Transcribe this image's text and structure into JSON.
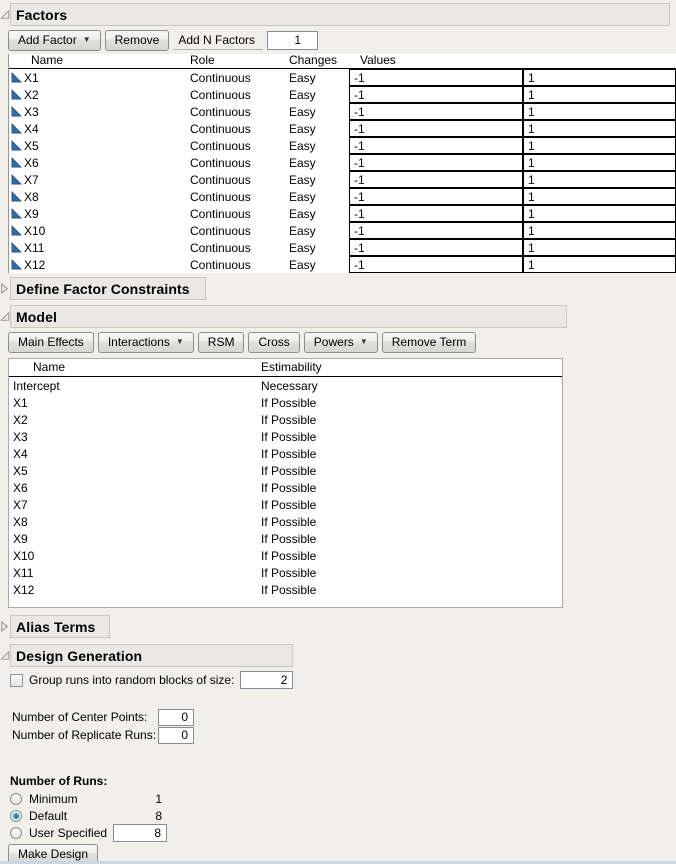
{
  "icons": {
    "dropdown_arrow": "▼"
  },
  "factors": {
    "title": "Factors",
    "toolbar": {
      "add_factor": "Add Factor",
      "remove": "Remove",
      "add_n_factors": "Add N Factors",
      "add_n_value": "1"
    },
    "columns": {
      "name": "Name",
      "role": "Role",
      "changes": "Changes",
      "values": "Values"
    },
    "rows": [
      {
        "name": "X1",
        "role": "Continuous",
        "changes": "Easy",
        "low": "-1",
        "high": "1"
      },
      {
        "name": "X2",
        "role": "Continuous",
        "changes": "Easy",
        "low": "-1",
        "high": "1"
      },
      {
        "name": "X3",
        "role": "Continuous",
        "changes": "Easy",
        "low": "-1",
        "high": "1"
      },
      {
        "name": "X4",
        "role": "Continuous",
        "changes": "Easy",
        "low": "-1",
        "high": "1"
      },
      {
        "name": "X5",
        "role": "Continuous",
        "changes": "Easy",
        "low": "-1",
        "high": "1"
      },
      {
        "name": "X6",
        "role": "Continuous",
        "changes": "Easy",
        "low": "-1",
        "high": "1"
      },
      {
        "name": "X7",
        "role": "Continuous",
        "changes": "Easy",
        "low": "-1",
        "high": "1"
      },
      {
        "name": "X8",
        "role": "Continuous",
        "changes": "Easy",
        "low": "-1",
        "high": "1"
      },
      {
        "name": "X9",
        "role": "Continuous",
        "changes": "Easy",
        "low": "-1",
        "high": "1"
      },
      {
        "name": "X10",
        "role": "Continuous",
        "changes": "Easy",
        "low": "-1",
        "high": "1"
      },
      {
        "name": "X11",
        "role": "Continuous",
        "changes": "Easy",
        "low": "-1",
        "high": "1"
      },
      {
        "name": "X12",
        "role": "Continuous",
        "changes": "Easy",
        "low": "-1",
        "high": "1"
      }
    ]
  },
  "constraints": {
    "title": "Define Factor Constraints"
  },
  "model": {
    "title": "Model",
    "toolbar": [
      {
        "label": "Main Effects",
        "dropdown": false
      },
      {
        "label": "Interactions",
        "dropdown": true
      },
      {
        "label": "RSM",
        "dropdown": false
      },
      {
        "label": "Cross",
        "dropdown": false
      },
      {
        "label": "Powers",
        "dropdown": true
      },
      {
        "label": "Remove Term",
        "dropdown": false
      }
    ],
    "columns": {
      "name": "Name",
      "estimability": "Estimability"
    },
    "rows": [
      {
        "name": "Intercept",
        "estimability": "Necessary"
      },
      {
        "name": "X1",
        "estimability": "If Possible"
      },
      {
        "name": "X2",
        "estimability": "If Possible"
      },
      {
        "name": "X3",
        "estimability": "If Possible"
      },
      {
        "name": "X4",
        "estimability": "If Possible"
      },
      {
        "name": "X5",
        "estimability": "If Possible"
      },
      {
        "name": "X6",
        "estimability": "If Possible"
      },
      {
        "name": "X7",
        "estimability": "If Possible"
      },
      {
        "name": "X8",
        "estimability": "If Possible"
      },
      {
        "name": "X9",
        "estimability": "If Possible"
      },
      {
        "name": "X10",
        "estimability": "If Possible"
      },
      {
        "name": "X11",
        "estimability": "If Possible"
      },
      {
        "name": "X12",
        "estimability": "If Possible"
      }
    ]
  },
  "alias": {
    "title": "Alias Terms"
  },
  "design_generation": {
    "title": "Design Generation",
    "group_runs_label": "Group runs into random blocks of size:",
    "group_runs_value": "2",
    "group_runs_checked": false,
    "center_points_label": "Number of Center Points:",
    "center_points_value": "0",
    "replicate_runs_label": "Number of Replicate Runs:",
    "replicate_runs_value": "0",
    "number_of_runs_label": "Number of Runs:",
    "runs_options": [
      {
        "label": "Minimum",
        "value": "1",
        "selected": false,
        "editable": false
      },
      {
        "label": "Default",
        "value": "8",
        "selected": true,
        "editable": false
      },
      {
        "label": "User Specified",
        "value": "8",
        "selected": false,
        "editable": true
      }
    ],
    "make_design_label": "Make Design"
  },
  "colors": {
    "background": "#f0efec",
    "header_box": "#e9e8e6",
    "continuous_icon_blue": "#2e6da8",
    "radio_selected_blue": "#15568c",
    "bottom_strip": "#ccd6e1"
  }
}
